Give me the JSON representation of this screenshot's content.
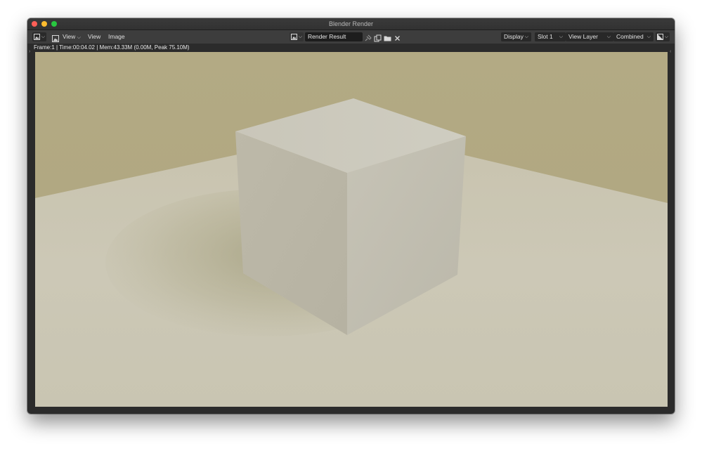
{
  "window": {
    "title": "Blender Render"
  },
  "header": {
    "editor_type_icon": "image-editor-icon",
    "view_mode_icon": "image-icon",
    "view_dropdown_label": "View",
    "menus": [
      "View",
      "Image"
    ],
    "browse_image_icon": "image-browse-icon",
    "image_name": "Render Result",
    "slot_tools_icons": [
      "pin-icon",
      "duplicate-icon",
      "open-folder-icon",
      "close-icon"
    ],
    "display_label": "Display",
    "slot_label": "Slot 1",
    "view_layer_label": "View Layer",
    "pass_label": "Combined",
    "display_channels_icon": "color-alpha-icon"
  },
  "status": {
    "text": "Frame:1 | Time:00:04.02 | Mem:43.33M (0.00M, Peak 75.10M)"
  },
  "render": {
    "subject": "cube",
    "colors": {
      "background": "#b3aa84",
      "floor": "#cbc6b4",
      "cube_top": "#c9c6bb",
      "cube_left": "#bfbbad",
      "cube_right": "#c4c0b2"
    }
  }
}
